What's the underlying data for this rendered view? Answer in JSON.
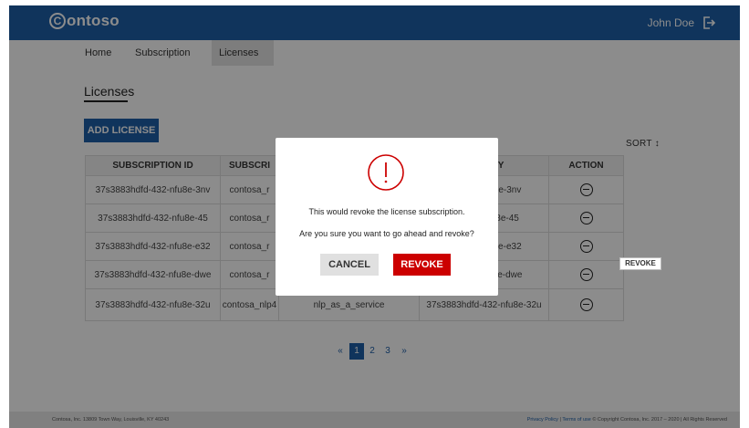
{
  "header": {
    "logo_text": "ontoso",
    "logo_mark": "C",
    "user_name": "John Doe",
    "logout_icon": "logout-icon"
  },
  "nav": {
    "items": [
      {
        "label": "Home"
      },
      {
        "label": "Subscription"
      },
      {
        "label": "Licenses",
        "active": true
      }
    ]
  },
  "page": {
    "title": "Licenses",
    "add_button": "ADD LICENSE",
    "sort_label": "SORT ↕"
  },
  "table": {
    "columns": [
      "SUBSCRIPTION ID",
      "SUBSCRI",
      "",
      "NSE KEY",
      "ACTION"
    ],
    "rows": [
      {
        "subscription_id": "37s3883hdfd-432-nfu8e-3nv",
        "subscription": "contosa_r",
        "product": "",
        "license_key": "dfd-432-nfu8e-3nv"
      },
      {
        "subscription_id": "37s3883hdfd-432-nfu8e-45",
        "subscription": "contosa_r",
        "product": "",
        "license_key": "dfd-432-nfu8e-45"
      },
      {
        "subscription_id": "37s3883hdfd-432-nfu8e-e32",
        "subscription": "contosa_r",
        "product": "",
        "license_key": "dfd-432-nfu8e-e32"
      },
      {
        "subscription_id": "37s3883hdfd-432-nfu8e-dwe",
        "subscription": "contosa_r",
        "product": "",
        "license_key": "dfd-432-nfu8e-dwe"
      },
      {
        "subscription_id": "37s3883hdfd-432-nfu8e-32u",
        "subscription": "contosa_nlp4",
        "product": "nlp_as_a_service",
        "license_key": "37s3883hdfd-432-nfu8e-32u"
      }
    ],
    "action_icon": "minus-circle-icon"
  },
  "tooltip": {
    "text": "REVOKE"
  },
  "pagination": {
    "prev": "«",
    "pages": [
      "1",
      "2",
      "3"
    ],
    "current": "1",
    "next": "»"
  },
  "footer": {
    "address": "Contosa, Inc. 13809 Town Way, Louisville, KY 40243",
    "privacy": "Privacy Policy",
    "separator": " | ",
    "terms": "Terms of use",
    "copyright": " © Copyright Contosa, Inc. 2017 – 2020 | All Rights Reserved"
  },
  "modal": {
    "icon": "alert-circle-icon",
    "message": "This would revoke the license subscription.",
    "question": "Are you sure you want to go ahead and revoke?",
    "cancel_label": "CANCEL",
    "revoke_label": "REVOKE"
  },
  "colors": {
    "brand": "#1e5fa8",
    "danger": "#cc0000"
  }
}
